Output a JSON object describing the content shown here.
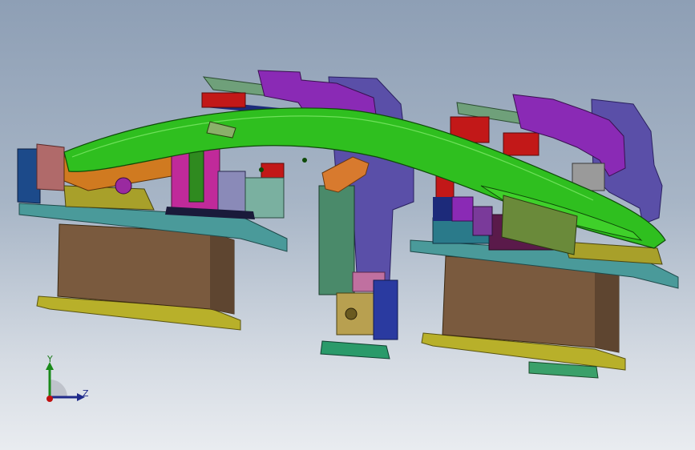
{
  "view": {
    "background_top": "#8e9fb5",
    "background_bottom": "#e9ecf0"
  },
  "triad": {
    "y_label": "Y",
    "z_label": "Z",
    "y_color": "#1a8a1a",
    "z_color": "#1f2a8a",
    "origin_color": "#c01010"
  },
  "colors": {
    "green_part": "#2fbf1f",
    "purple": "#8a2ab5",
    "slate_blue": "#5a4fa8",
    "teal_plate": "#4a9a9a",
    "brown_block": "#7a5a3e",
    "olive_plate": "#b8b02a",
    "red": "#c21818",
    "navy": "#1c2a7a",
    "orange": "#d87a2e",
    "magenta": "#c02a9a",
    "sage": "#6fa07a",
    "gray": "#8a8a8a"
  }
}
